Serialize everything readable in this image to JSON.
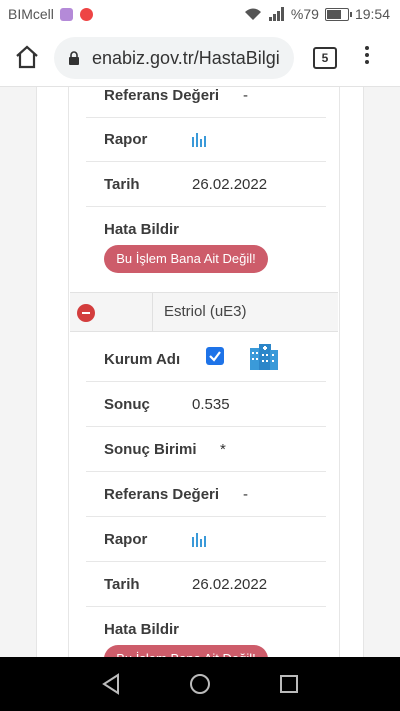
{
  "status_bar": {
    "carrier": "BIMcell",
    "battery": "%79",
    "time": "19:54",
    "battery_level": 0.79
  },
  "browser": {
    "url": "enabiz.gov.tr/HastaBilgi",
    "tab_count": "5"
  },
  "record_prev": {
    "reference_label": "Referans Değeri",
    "reference_value": "-",
    "report_label": "Rapor",
    "date_label": "Tarih",
    "date_value": "26.02.2022",
    "error_label": "Hata Bildir",
    "error_button": "Bu İşlem Bana Ait Değil!"
  },
  "record": {
    "test_name": "Estriol (uE3)",
    "institution_label": "Kurum Adı",
    "result_label": "Sonuç",
    "result_value": "0.535",
    "unit_label": "Sonuç Birimi",
    "unit_value": "*",
    "reference_label": "Referans Değeri",
    "reference_value": "-",
    "report_label": "Rapor",
    "date_label": "Tarih",
    "date_value": "26.02.2022",
    "error_label": "Hata Bildir",
    "error_button": "Bu İşlem Bana Ait Değil!"
  },
  "colors": {
    "accent_red": "#cd5c6a",
    "checkbox_blue": "#1e73e8",
    "icon_blue": "#3a9ad9"
  }
}
